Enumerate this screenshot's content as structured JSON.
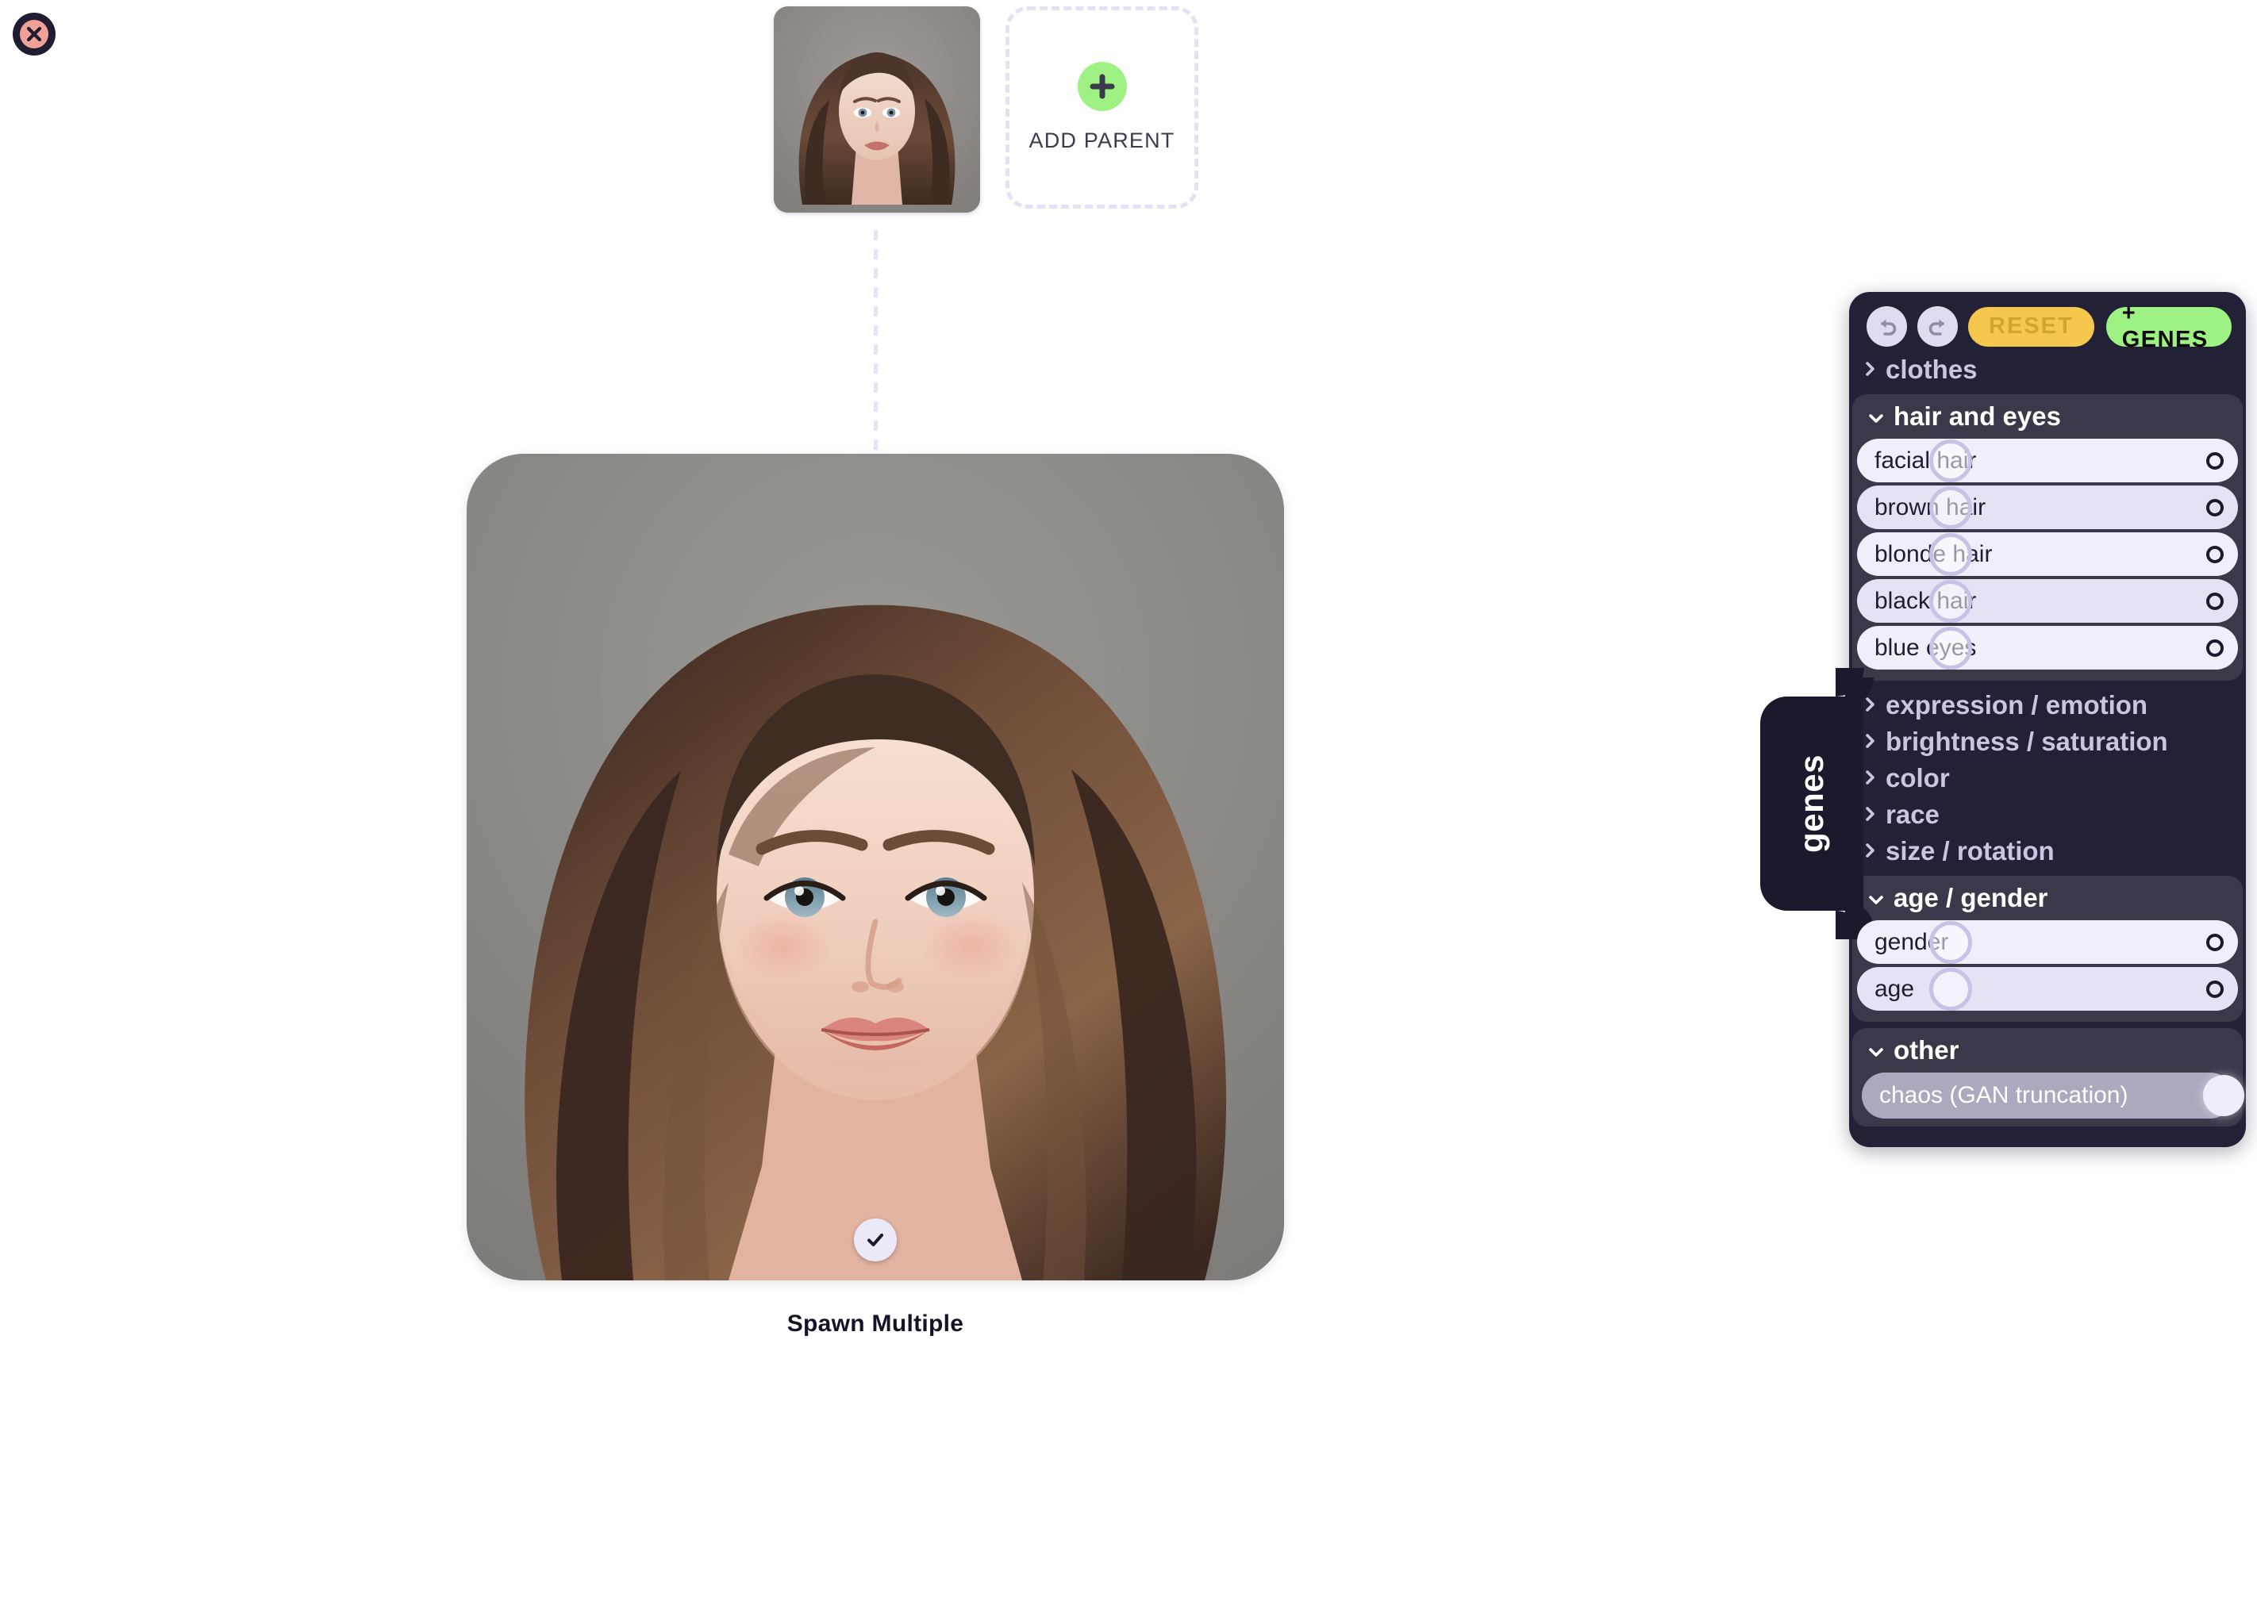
{
  "window": {
    "close_label": "close"
  },
  "tree": {
    "parent_thumb_name": "parent portrait",
    "add_parent": {
      "label": "ADD PARENT",
      "plus_icon": "plus-icon",
      "accent": "#9ef283"
    },
    "child": {
      "portrait_name": "child portrait",
      "check_icon": "check-icon",
      "spawn_label": "Spawn Multiple"
    }
  },
  "genes_panel": {
    "tab_label": "genes",
    "toolbar": {
      "undo_icon": "undo-icon",
      "redo_icon": "redo-icon",
      "reset_label": "RESET",
      "reset_color": "#f5c74e",
      "add_genes_label": "+ GENES",
      "add_genes_color": "#9ef283"
    },
    "sections": [
      {
        "id": "clothes",
        "label": "clothes",
        "open": false,
        "chevron": "chevron-right-icon",
        "genes": []
      },
      {
        "id": "hair-and-eyes",
        "label": "hair and eyes",
        "open": true,
        "chevron": "chevron-down-icon",
        "genes": [
          {
            "label": "facial hair",
            "value": 0.245
          },
          {
            "label": "brown hair",
            "value": 0.245
          },
          {
            "label": "blonde hair",
            "value": 0.245
          },
          {
            "label": "black hair",
            "value": 0.245
          },
          {
            "label": "blue eyes",
            "value": 0.245
          }
        ]
      },
      {
        "id": "expression-emotion",
        "label": "expression / emotion",
        "open": false,
        "chevron": "chevron-right-icon",
        "genes": []
      },
      {
        "id": "brightness-saturation",
        "label": "brightness / saturation",
        "open": false,
        "chevron": "chevron-right-icon",
        "genes": []
      },
      {
        "id": "color",
        "label": "color",
        "open": false,
        "chevron": "chevron-right-icon",
        "genes": []
      },
      {
        "id": "race",
        "label": "race",
        "open": false,
        "chevron": "chevron-right-icon",
        "genes": []
      },
      {
        "id": "size-rotation",
        "label": "size / rotation",
        "open": false,
        "chevron": "chevron-right-icon",
        "genes": []
      },
      {
        "id": "age-gender",
        "label": "age / gender",
        "open": true,
        "chevron": "chevron-down-icon",
        "genes": [
          {
            "label": "gender",
            "value": 0.245
          },
          {
            "label": "age",
            "value": 0.245
          }
        ]
      },
      {
        "id": "other",
        "label": "other",
        "open": true,
        "chevron": "chevron-down-icon",
        "genes": [
          {
            "label": "chaos (GAN truncation)",
            "value": 0.975,
            "style": "chaos"
          }
        ]
      }
    ]
  },
  "colors": {
    "panel_bg": "#232135",
    "section_bg": "#3a3949",
    "tab_bg": "#1b192c",
    "row_bg": "#f0eefa",
    "row_bg_alt": "#e4e2f3",
    "handle_ring": "#c6c3e6",
    "close_ring": "#201d33",
    "close_fill": "#f2a199",
    "connector": "#e6e4f8"
  }
}
